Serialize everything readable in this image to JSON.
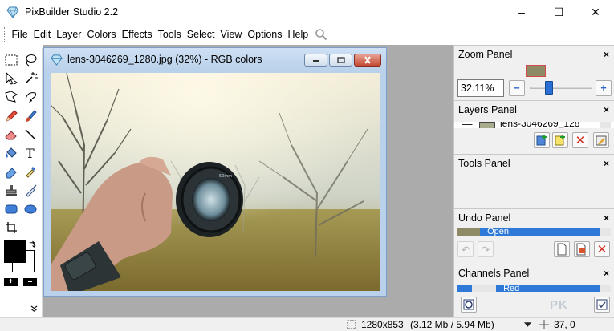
{
  "window": {
    "title": "PixBuilder Studio 2.2",
    "controls": {
      "minimize": "–",
      "maximize": "☐",
      "close": "✕"
    }
  },
  "menu": [
    "File",
    "Edit",
    "Layer",
    "Colors",
    "Effects",
    "Tools",
    "Select",
    "View",
    "Options",
    "Help"
  ],
  "image_window": {
    "title": "lens-3046269_1280.jpg (32%) - RGB colors"
  },
  "panels": {
    "zoom": {
      "title": "Zoom Panel",
      "value": "32.11%",
      "slider_level": 0.4
    },
    "layers": {
      "title": "Layers Panel",
      "layer_name": "lens-3046269_128"
    },
    "tools": {
      "title": "Tools Panel"
    },
    "undo": {
      "title": "Undo Panel",
      "item": "Open"
    },
    "channels": {
      "title": "Channels Panel",
      "item": "Red"
    }
  },
  "toolbox": {
    "icons": [
      "rect-select-icon",
      "lasso-icon",
      "move-icon",
      "magic-wand-icon",
      "polygon-lasso-icon",
      "magnetic-lasso-icon",
      "pencil-icon",
      "brush-icon",
      "eraser-icon",
      "line-icon",
      "fill-icon",
      "text-icon",
      "eraser-alt-icon",
      "dropper-icon",
      "stamp-icon",
      "syringe-icon",
      "rounded-rect-icon",
      "ellipse-icon",
      "crop-icon"
    ],
    "fg_color": "#000000",
    "bg_color": "#ffffff"
  },
  "status": {
    "dimensions": "1280x853",
    "memory": "(3.12 Mb / 5.94 Mb)",
    "coords": "37, 0"
  },
  "watermark": "PK",
  "colors": {
    "accent": "#2f7ad8",
    "workspace": "#ababab",
    "close_red": "#c42b1c"
  }
}
